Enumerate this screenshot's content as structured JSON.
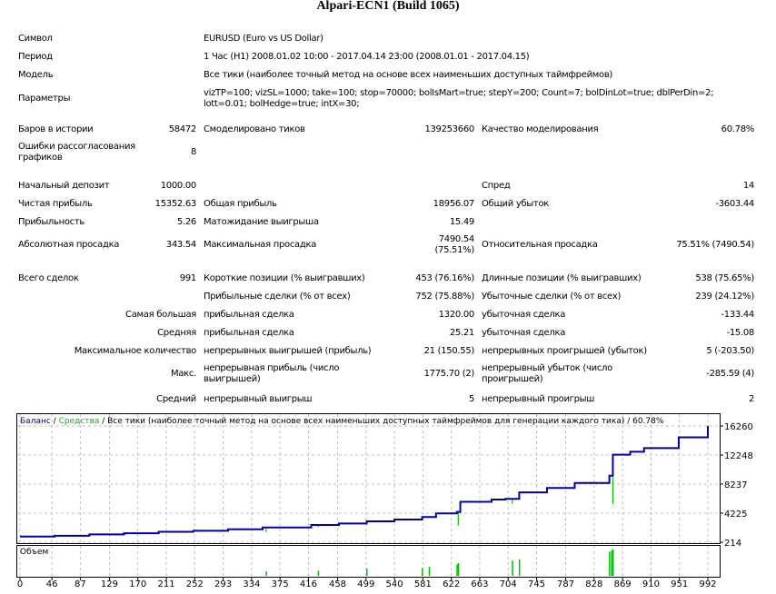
{
  "title": "Alpari-ECN1 (Build 1065)",
  "info": [
    {
      "label": "Символ",
      "value": "EURUSD (Euro vs US Dollar)"
    },
    {
      "label": "Период",
      "value": "1 Час (H1) 2008.01.02 10:00 - 2017.04.14 23:00 (2008.01.01 - 2017.04.15)"
    },
    {
      "label": "Модель",
      "value": "Все тики (наиболее точный метод на основе всех наименьших доступных таймфреймов)"
    },
    {
      "label": "Параметры",
      "value": "vizTP=100; vizSL=1000; take=100; stop=70000; bolIsMart=true; stepY=200; Count=7; bolDinLot=true; dblPerDin=2;",
      "value2": "lott=0.01; bolHedge=true; intX=30;"
    }
  ],
  "stats": [
    [
      "Баров в истории",
      "58472",
      "Смоделировано тиков",
      "139253660",
      "Качество моделирования",
      "60.78%"
    ],
    [
      "Ошибки рассогласования|графиков",
      "8",
      "",
      "",
      "",
      ""
    ],
    [
      "Начальный депозит",
      "1000.00",
      "",
      "",
      "Спред",
      "14"
    ],
    [
      "Чистая прибыль",
      "15352.63",
      "Общая прибыль",
      "18956.07",
      "Общий убыток",
      "-3603.44"
    ],
    [
      "Прибыльность",
      "5.26",
      "Матожидание выигрыша",
      "15.49",
      "",
      ""
    ],
    [
      "Абсолютная просадка",
      "343.54",
      "Максимальная просадка",
      "7490.54|(75.51%)",
      "Относительная просадка",
      "75.51% (7490.54)"
    ],
    [
      "Всего сделок",
      "991",
      "Короткие позиции (% выигравших)",
      "453 (76.16%)",
      "Длинные позиции (% выигравших)",
      "538 (75.65%)"
    ],
    [
      "",
      "",
      "Прибыльные сделки (% от всех)",
      "752 (75.88%)",
      "Убыточные сделки (% от всех)",
      "239 (24.12%)"
    ],
    [
      "Самая большая",
      "",
      "прибыльная сделка",
      "1320.00",
      "убыточная сделка",
      "-133.44"
    ],
    [
      "Средняя",
      "",
      "прибыльная сделка",
      "25.21",
      "убыточная сделка",
      "-15.08"
    ],
    [
      "Максимальное количество",
      "",
      "непрерывных выигрышей (прибыль)",
      "21 (150.55)",
      "непрерывных проигрышей (убыток)",
      "5 (-203.50)"
    ],
    [
      "Макс.",
      "",
      "непрерывная прибыль (число|выигрышей)",
      "1775.70 (2)",
      "непрерывный убыток (число|проигрышей)",
      "-285.59 (4)"
    ],
    [
      "Средний",
      "",
      "непрерывный выигрыш",
      "5",
      "непрерывный проигрыш",
      "2"
    ]
  ],
  "chart_data": {
    "type": "line",
    "legend": {
      "balance": "Баланс",
      "sep1": " / ",
      "equity": "Средства",
      "rest": " / Все тики (наиболее точный метод на основе всех наименьших доступных таймфреймов для генерации каждого тика) / 60.78%"
    },
    "volume_label": "Объем",
    "x_ticks": [
      0,
      46,
      87,
      129,
      170,
      211,
      252,
      293,
      334,
      375,
      416,
      458,
      499,
      540,
      581,
      622,
      663,
      704,
      745,
      787,
      828,
      869,
      910,
      951,
      992
    ],
    "y_ticks": [
      214,
      4225,
      8237,
      12248,
      16260
    ],
    "xlim": [
      0,
      992
    ],
    "ylim": [
      214,
      16260
    ],
    "balance": [
      [
        0,
        1000
      ],
      [
        50,
        1100
      ],
      [
        100,
        1300
      ],
      [
        150,
        1450
      ],
      [
        200,
        1650
      ],
      [
        250,
        1800
      ],
      [
        300,
        2000
      ],
      [
        350,
        2250
      ],
      [
        420,
        2600
      ],
      [
        460,
        2800
      ],
      [
        500,
        3100
      ],
      [
        540,
        3350
      ],
      [
        580,
        3700
      ],
      [
        600,
        4200
      ],
      [
        630,
        4400
      ],
      [
        635,
        5800
      ],
      [
        680,
        6100
      ],
      [
        700,
        6200
      ],
      [
        720,
        7100
      ],
      [
        760,
        7700
      ],
      [
        800,
        8400
      ],
      [
        850,
        9400
      ],
      [
        855,
        12300
      ],
      [
        880,
        12700
      ],
      [
        900,
        13200
      ],
      [
        950,
        14700
      ],
      [
        992,
        16260
      ]
    ],
    "equity_dips": [
      [
        355,
        1600
      ],
      [
        430,
        2300
      ],
      [
        500,
        2700
      ],
      [
        580,
        3400
      ],
      [
        632,
        2500
      ],
      [
        710,
        5500
      ],
      [
        855,
        5500
      ]
    ],
    "volume": [
      [
        355,
        0.35
      ],
      [
        430,
        0.4
      ],
      [
        500,
        0.55
      ],
      [
        580,
        0.6
      ],
      [
        590,
        0.7
      ],
      [
        630,
        0.9
      ],
      [
        632,
        1.0
      ],
      [
        710,
        1.2
      ],
      [
        720,
        1.3
      ],
      [
        850,
        1.9
      ],
      [
        853,
        2.0
      ],
      [
        855,
        2.1
      ]
    ],
    "colors": {
      "balance": "#0000a0",
      "equity": "#00c000",
      "grid": "#c0c0c0"
    }
  }
}
